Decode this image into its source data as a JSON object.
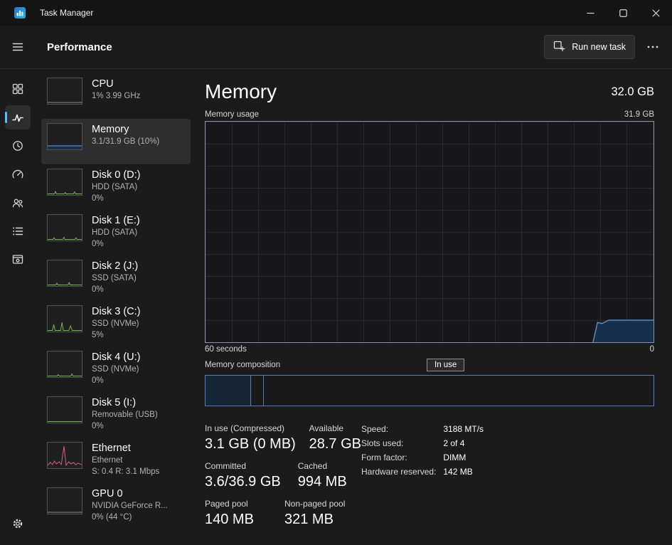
{
  "window": {
    "title": "Task Manager"
  },
  "header": {
    "title": "Performance",
    "run_new_task_label": "Run new task"
  },
  "rail_items": [
    "processes",
    "performance",
    "app-history",
    "startup-apps",
    "users",
    "details",
    "services",
    "settings"
  ],
  "sidebar": {
    "items": [
      {
        "title": "CPU",
        "sub1": "1% 3.99 GHz",
        "sub2": ""
      },
      {
        "title": "Memory",
        "sub1": "3.1/31.9 GB (10%)",
        "sub2": ""
      },
      {
        "title": "Disk 0 (D:)",
        "sub1": "HDD (SATA)",
        "sub2": "0%"
      },
      {
        "title": "Disk 1 (E:)",
        "sub1": "HDD (SATA)",
        "sub2": "0%"
      },
      {
        "title": "Disk 2 (J:)",
        "sub1": "SSD (SATA)",
        "sub2": "0%"
      },
      {
        "title": "Disk 3 (C:)",
        "sub1": "SSD (NVMe)",
        "sub2": "5%"
      },
      {
        "title": "Disk 4 (U:)",
        "sub1": "SSD (NVMe)",
        "sub2": "0%"
      },
      {
        "title": "Disk 5 (I:)",
        "sub1": "Removable (USB)",
        "sub2": "0%"
      },
      {
        "title": "Ethernet",
        "sub1": "Ethernet",
        "sub2": "S: 0.4 R: 3.1 Mbps"
      },
      {
        "title": "GPU 0",
        "sub1": "NVIDIA GeForce R...",
        "sub2": "0% (44 °C)"
      }
    ]
  },
  "main": {
    "title": "Memory",
    "total": "32.0 GB",
    "usage_label": "Memory usage",
    "usage_max": "31.9 GB",
    "x_left": "60 seconds",
    "x_right": "0",
    "composition_label": "Memory composition",
    "in_use_tag": "In use",
    "composition": {
      "in_use_width": "10.2%",
      "modified_width": "2.8%"
    },
    "stats_rows": [
      {
        "c1_label": "In use (Compressed)",
        "c1_value": "3.1 GB (0 MB)",
        "c2_label": "Available",
        "c2_value": "28.7 GB"
      },
      {
        "c1_label": "Committed",
        "c1_value": "3.6/36.9 GB",
        "c2_label": "Cached",
        "c2_value": "994 MB"
      },
      {
        "c1_label": "Paged pool",
        "c1_value": "140 MB",
        "c2_label": "Non-paged pool",
        "c2_value": "321 MB"
      }
    ],
    "details": [
      {
        "label": "Speed:",
        "value": "3188 MT/s"
      },
      {
        "label": "Slots used:",
        "value": "2 of 4"
      },
      {
        "label": "Form factor:",
        "value": "DIMM"
      },
      {
        "label": "Hardware reserved:",
        "value": "142 MB"
      }
    ]
  },
  "colors": {
    "accent_memory_line": "#5d8ac0",
    "accent_memory_fill": "#16304c",
    "graph_border": "#8a90a8",
    "composition_border": "#4d7ec0",
    "composition_in_use_fill": "#152638",
    "disk_green": "#76b55e",
    "ethernet_pink": "#d9618f",
    "thumb_gray": "#8a8a8a",
    "rail_accent": "#4cc2ff"
  },
  "chart_data": {
    "type": "area",
    "title": "Memory usage",
    "x_axis": {
      "left_label": "60 seconds",
      "right_label": "0",
      "span_seconds": 60
    },
    "y_axis": {
      "min": 0,
      "max_label": "31.9 GB"
    },
    "series": [
      {
        "name": "Memory in use (% of 31.9 GB)",
        "points": [
          [
            86.5,
            0
          ],
          [
            87.5,
            9
          ],
          [
            88.5,
            8.5
          ],
          [
            90,
            10
          ],
          [
            95,
            10
          ],
          [
            100,
            10
          ]
        ]
      }
    ]
  }
}
